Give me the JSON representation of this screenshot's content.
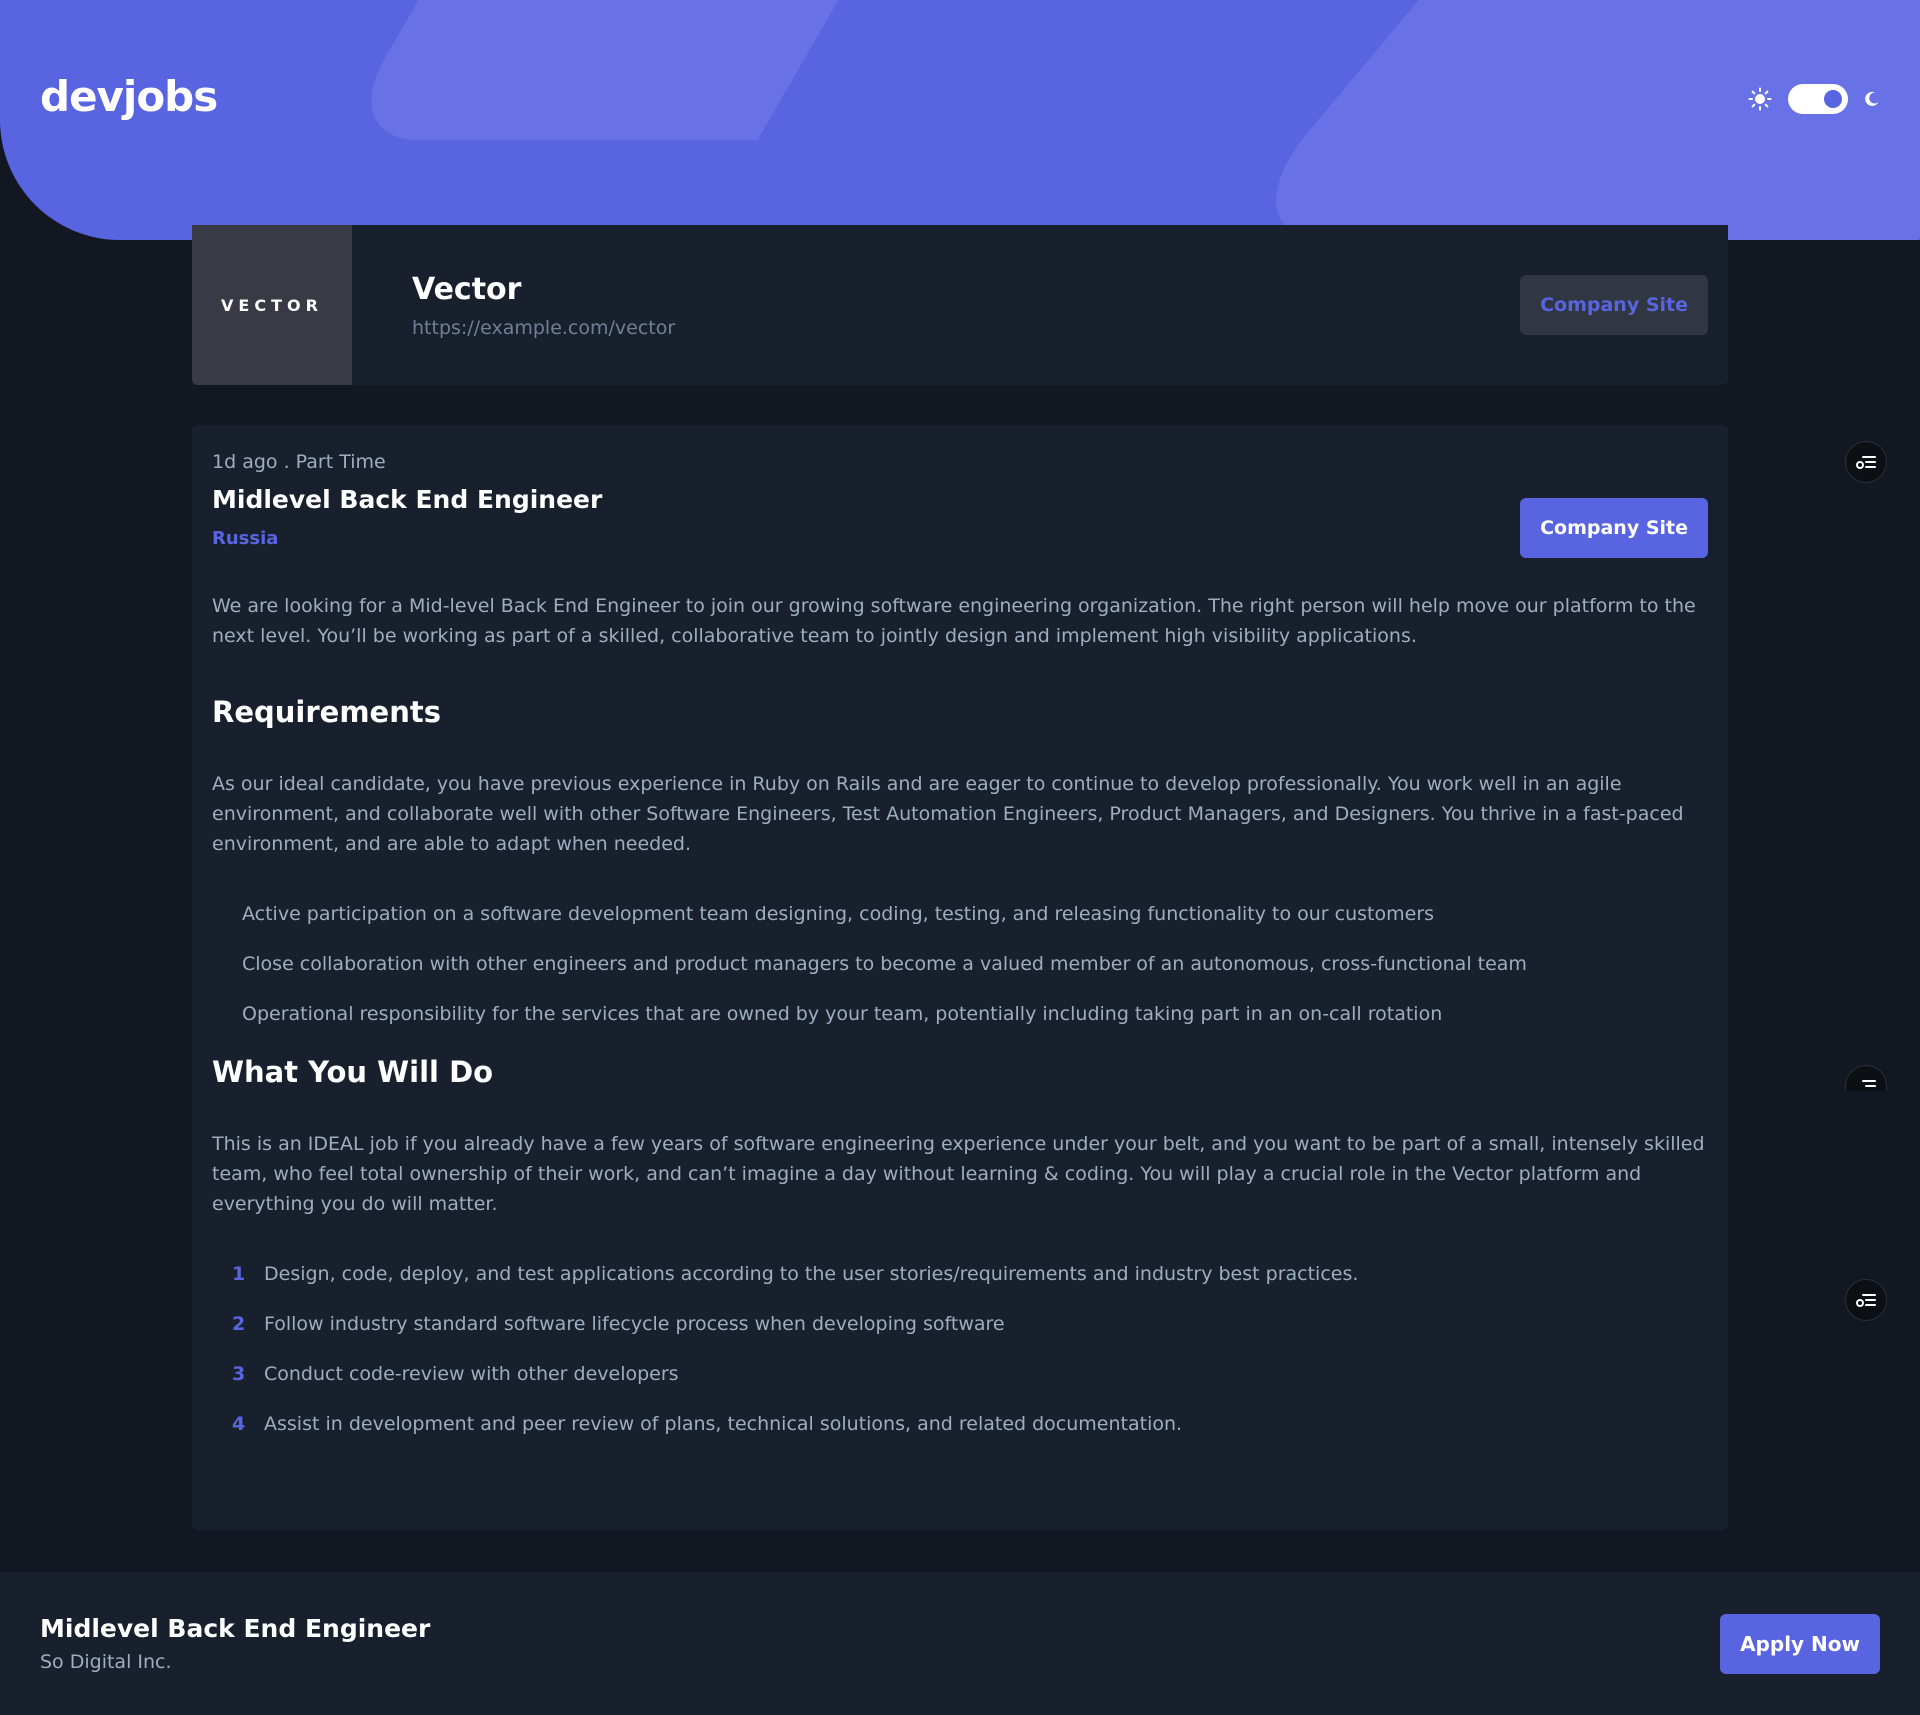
{
  "brand": {
    "logo_text": "devjobs"
  },
  "theme": {
    "mode": "dark",
    "toggle_on": true,
    "sun_icon": "sun-icon",
    "moon_icon": "moon-icon"
  },
  "colors": {
    "accent": "#5964e0",
    "page_bg": "#121721",
    "card_bg": "#19202d",
    "text_muted": "#9daec2",
    "heading": "#ffffff"
  },
  "company": {
    "logo_text": "VECTOR",
    "name": "Vector",
    "url": "https://example.com/vector",
    "site_button_label": "Company Site"
  },
  "job": {
    "posted": "1d ago",
    "separator": " . ",
    "contract": "Part Time",
    "title": "Midlevel Back End Engineer",
    "location": "Russia",
    "site_button_label": "Company Site",
    "description": "We are looking for a Mid-level Back End Engineer to join our growing software engineering organization. The right person will help move our platform to the next level. You’ll be working as part of a skilled, collaborative team to jointly design and implement high visibility applications.",
    "requirements": {
      "heading": "Requirements",
      "content": "As our ideal candidate, you have previous experience in Ruby on Rails and are eager to continue to develop professionally. You work well in an agile environment, and collaborate well with other Software Engineers, Test Automation Engineers, Product Managers, and Designers. You thrive in a fast-paced environment, and are able to adapt when needed.",
      "items": [
        "Active participation on a software development team designing, coding, testing, and releasing functionality to our customers",
        "Close collaboration with other engineers and product managers to become a valued member of an autonomous, cross-functional team",
        "Operational responsibility for the services that are owned by your team, potentially including taking part in an on-call rotation"
      ]
    },
    "role": {
      "heading": "What You Will Do",
      "content": "This is an IDEAL job if you already have a few years of software engineering experience under your belt, and you want to be part of a small, intensely skilled team, who feel total ownership of their work, and can’t imagine a day without learning & coding. You will play a crucial role in the Vector platform and everything you do will matter.",
      "items": [
        {
          "num": "1",
          "text": "Design, code, deploy, and test applications according to the user stories/requirements and industry best practices."
        },
        {
          "num": "2",
          "text": "Follow industry standard software lifecycle process when developing software"
        },
        {
          "num": "3",
          "text": "Conduct code-review with other developers"
        },
        {
          "num": "4",
          "text": "Assist in development and peer review of plans, technical solutions, and related documentation."
        }
      ]
    }
  },
  "footer": {
    "title": "Midlevel Back End Engineer",
    "company": "So Digital Inc.",
    "apply_label": "Apply Now"
  },
  "side_icons": [
    "filter-settings-icon",
    "filter-settings-icon",
    "filter-settings-icon"
  ]
}
